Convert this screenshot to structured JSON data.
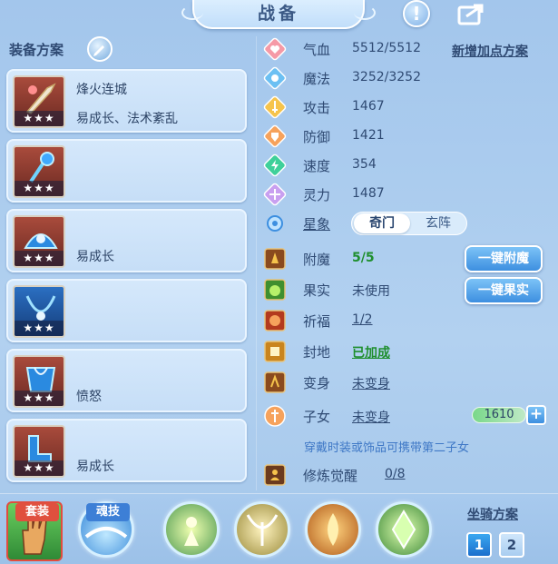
{
  "title": "战备",
  "left": {
    "header": "装备方案",
    "plans": [
      {
        "name": "烽火连城",
        "desc": "易成长、法术紊乱",
        "stars": "★★★"
      },
      {
        "name": "",
        "desc": "",
        "stars": "★★★"
      },
      {
        "name": "",
        "desc": "易成长",
        "stars": "★★★"
      },
      {
        "name": "",
        "desc": "",
        "stars": "★★★"
      },
      {
        "name": "",
        "desc": "愤怒",
        "stars": "★★★"
      },
      {
        "name": "",
        "desc": "易成长",
        "stars": "★★★"
      }
    ]
  },
  "stats": {
    "add_plan_link": "新增加点方案",
    "hp": {
      "label": "气血",
      "value": "5512/5512"
    },
    "mp": {
      "label": "魔法",
      "value": "3252/3252"
    },
    "atk": {
      "label": "攻击",
      "value": "1467"
    },
    "def": {
      "label": "防御",
      "value": "1421"
    },
    "spd": {
      "label": "速度",
      "value": "354"
    },
    "spirit": {
      "label": "灵力",
      "value": "1487"
    },
    "xingxiang": {
      "label": "星象",
      "options": [
        "奇门",
        "玄阵"
      ]
    },
    "fumo": {
      "label": "附魔",
      "value": "5/5",
      "button": "一键附魔"
    },
    "guoshi": {
      "label": "果实",
      "value": "未使用",
      "button": "一键果实"
    },
    "qifu": {
      "label": "祈福",
      "value": "1/2"
    },
    "fengdi": {
      "label": "封地",
      "value": "已加成"
    },
    "bianshen": {
      "label": "变身",
      "value": "未变身"
    },
    "zinv": {
      "label": "子女",
      "value": "未变身",
      "count": "1610",
      "plus": "+"
    },
    "hint": "穿戴时装或饰品可携带第二子女",
    "xiulian": {
      "label": "修炼觉醒",
      "value": "0/8"
    }
  },
  "bottom": {
    "tag_set": "套装",
    "tag_soul": "魂技",
    "mount_label": "坐骑方案",
    "mount_options": [
      "1",
      "2"
    ]
  },
  "colors": {
    "accent": "#3d8fe0",
    "value_green": "#1f8f2e",
    "hint_blue": "#3f78c6"
  }
}
